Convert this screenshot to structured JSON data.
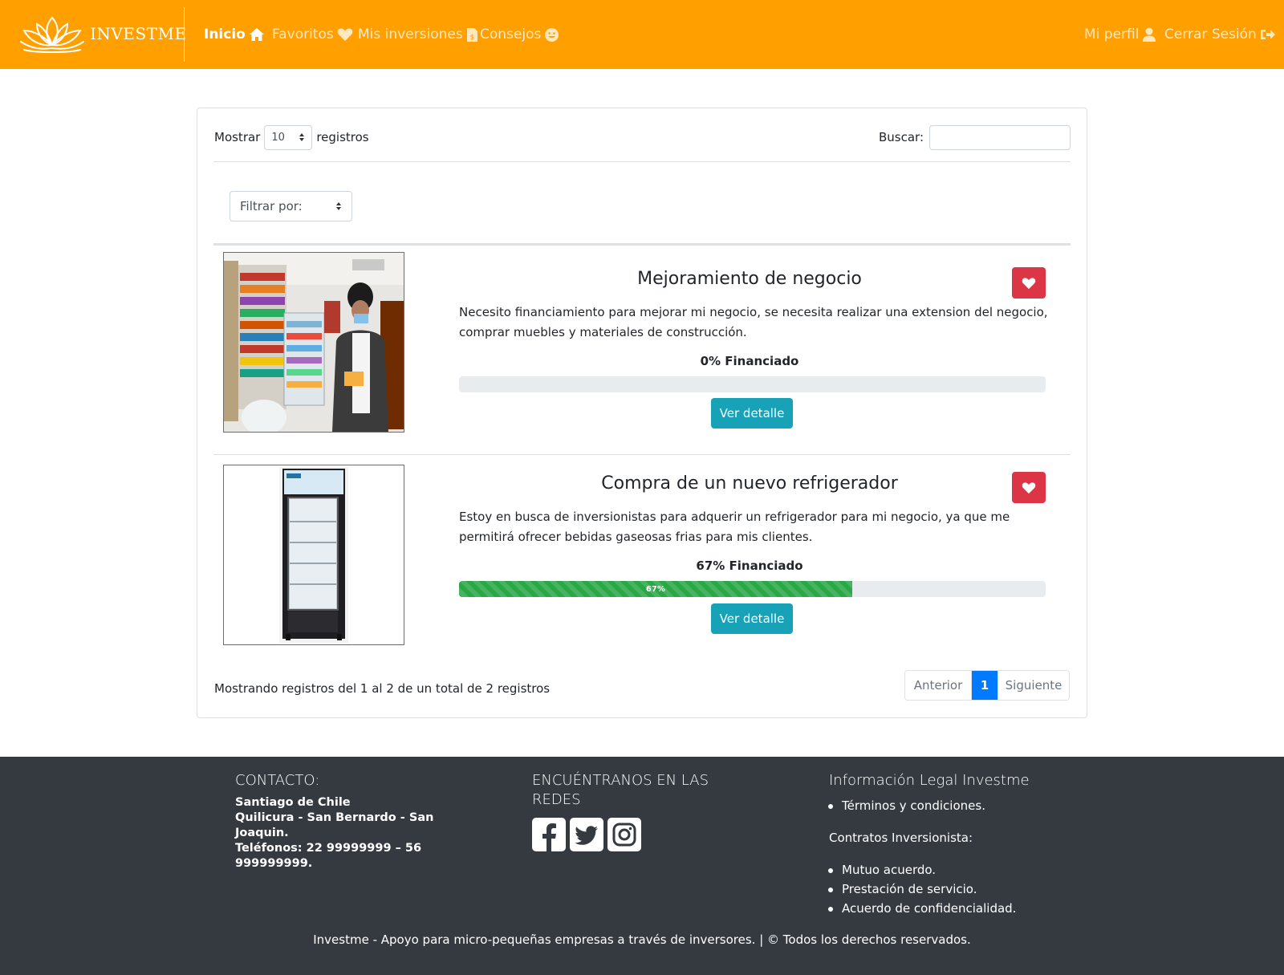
{
  "navbar": {
    "brand": "INVESTME",
    "links": [
      {
        "label": "Inicio",
        "icon": "home-icon"
      },
      {
        "label": "Favoritos",
        "icon": "heart-icon"
      },
      {
        "label": "Mis inversiones",
        "icon": "file-invoice-dollar-icon"
      },
      {
        "label": "Consejos",
        "icon": "smile-icon"
      }
    ],
    "right_links": [
      {
        "label": "Mi perfil",
        "icon": "user-icon"
      },
      {
        "label": "Cerrar Sesión",
        "icon": "sign-out-icon"
      }
    ],
    "colors": {
      "background": "#ff9f00"
    }
  },
  "table": {
    "show_label": "Mostrar",
    "page_length": "10",
    "records_label": "registros",
    "search_label": "Buscar:",
    "search_value": "",
    "filter_placeholder": "Filtrar por:",
    "info": "Mostrando registros del 1 al 2 de un total de 2 registros",
    "pagination": {
      "previous": "Anterior",
      "current": "1",
      "next": "Siguiente"
    }
  },
  "projects": [
    {
      "title": "Mejoramiento de negocio",
      "description": "Necesito financiamiento para mejorar mi negocio, se necesita realizar una extension del negocio, comprar muebles y materiales de construcción.",
      "funded_label": "0% Financiado",
      "funded_fraction": 0,
      "progress_text": "",
      "button_label": "Ver detalle",
      "image": "store-owner-photo"
    },
    {
      "title": "Compra de un nuevo refrigerador",
      "description": "Estoy en busca de inversionistas para adquerir un refrigerador para mi negocio, ya que me permitirá ofrecer bebidas gaseosas frias para mis clientes.",
      "funded_label": "67% Financiado",
      "funded_fraction": 0.67,
      "progress_text": "67%",
      "button_label": "Ver detalle",
      "image": "refrigerator-photo"
    }
  ],
  "footer": {
    "contact_heading": "CONTACTO:",
    "contact_lines": [
      "Santiago de Chile",
      "Quilicura - San Bernardo - San Joaquin.",
      "Teléfonos: 22 99999999 – 56 999999999."
    ],
    "social_heading": "ENCUÉNTRANOS EN LAS REDES",
    "social_icons": [
      "facebook-icon",
      "twitter-icon",
      "instagram-icon"
    ],
    "legal_heading": "Información Legal Investme",
    "legal_items": [
      "Términos y condiciones."
    ],
    "contracts_heading": "Contratos Inversionista:",
    "contracts_items": [
      "Mutuo acuerdo.",
      "Prestación de servicio.",
      "Acuerdo de confidencialidad."
    ],
    "bottom_text": "Investme - Apoyo para micro-pequeñas empresas a través de inversores. | © Todos los derechos reservados."
  }
}
